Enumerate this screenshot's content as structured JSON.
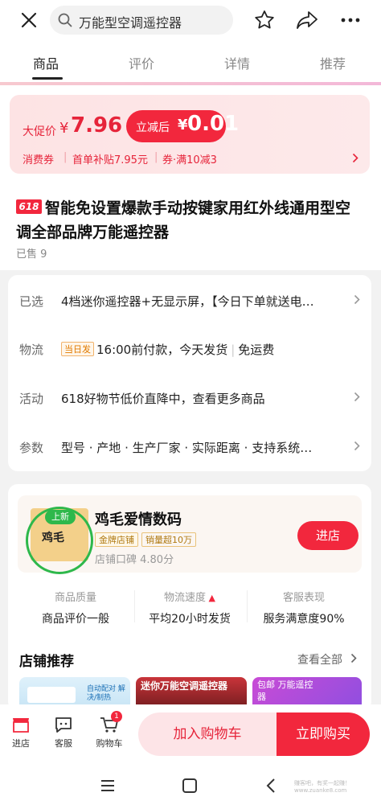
{
  "search": {
    "query": "万能型空调遥控器"
  },
  "tabs": [
    {
      "label": "商品",
      "active": true
    },
    {
      "label": "评价",
      "active": false
    },
    {
      "label": "详情",
      "active": false
    },
    {
      "label": "推荐",
      "active": false
    }
  ],
  "price": {
    "promo_label": "大促价",
    "currency": "¥",
    "promo_price": "7.96",
    "after_label": "立减后",
    "final_price": "0.01",
    "coupons": [
      "消费券",
      "首单补贴7.95元",
      "券·满10减3"
    ]
  },
  "product": {
    "badge": "618",
    "title": "智能免设置爆款手动按键家用红外线通用型空调全部品牌万能遥控器",
    "sold": "已售 9"
  },
  "specs": [
    {
      "label": "已选",
      "value": "4档迷你遥控器+无显示屏，【今日下单就送电…"
    },
    {
      "label": "物流",
      "tag": "当日发",
      "value": "16:00前付款，今天发货",
      "extra": "免运费"
    },
    {
      "label": "活动",
      "value": "618好物节低价直降中，查看更多商品"
    },
    {
      "label": "参数",
      "value": "型号 · 产地 · 生产厂家 · 实际距离 · 支持系统…"
    }
  ],
  "store": {
    "new_tag": "上新",
    "logo_text": "鸡毛",
    "name": "鸡毛爱情数码",
    "gold_badge": "金牌店铺",
    "sales_badge": "销量超10万",
    "rating": "店铺口碑 4.80分",
    "enter_label": "进店",
    "stats": [
      {
        "key": "商品质量",
        "value": "商品评价一般"
      },
      {
        "key": "物流速度",
        "value": "平均20小时发货"
      },
      {
        "key": "客服表现",
        "value": "服务满意度90%"
      }
    ],
    "recommend_title": "店铺推荐",
    "view_all": "查看全部",
    "thumbs": [
      {
        "text": "自动配对 解决/制热"
      },
      {
        "text": "迷你万能空调遥控器"
      },
      {
        "text": "包邮 万能遥控器"
      }
    ]
  },
  "bottom": {
    "store_label": "进店",
    "service_label": "客服",
    "cart_label": "购物车",
    "cart_count": "1",
    "add_cart": "加入购物车",
    "buy_now": "立即购买"
  },
  "watermark": "赚客吧，有奖一起赚！ www.zuanke8.com",
  "colors": {
    "accent": "#f2273d",
    "new_green": "#2eb84b"
  }
}
